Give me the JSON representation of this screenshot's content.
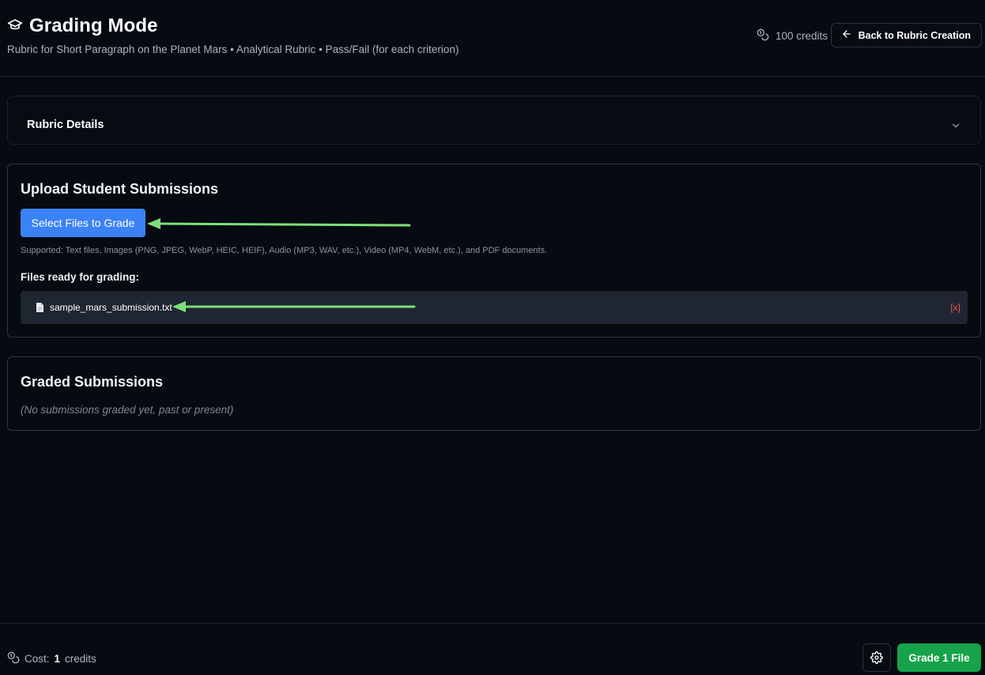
{
  "header": {
    "title": "Grading Mode",
    "title_icon": "graduation-cap-icon",
    "subtitle": "Rubric for Short Paragraph on the Planet Mars • Analytical Rubric • Pass/Fail (for each criterion)",
    "credits": "100 credits",
    "credits_icon": "coins-icon",
    "back_button": "Back to Rubric Creation"
  },
  "rubric_details": {
    "label": "Rubric Details",
    "icon": "chevron-down-icon"
  },
  "upload": {
    "title": "Upload Student Submissions",
    "select_button": "Select Files to Grade",
    "supported_text": "Supported: Text files, Images (PNG, JPEG, WebP, HEIC, HEIF), Audio (MP3, WAV, etc.), Video (MP4, WebM, etc.), and PDF documents.",
    "ready_label": "Files ready for grading:",
    "files": [
      {
        "name": "sample_mars_submission.txt",
        "remove_label": "[x]"
      }
    ]
  },
  "graded": {
    "title": "Graded Submissions",
    "empty_text": "(No submissions graded yet, past or present)"
  },
  "footer": {
    "cost_prefix": "Cost:",
    "cost_value": "1",
    "cost_suffix": "credits",
    "grade_button": "Grade 1 File",
    "settings_icon": "gear-icon"
  },
  "colors": {
    "background": "#060b12",
    "primary_button": "#3b82f6",
    "grade_button": "#16a34a",
    "annotation_arrow": "#7ee07a",
    "remove": "#e5534b"
  }
}
